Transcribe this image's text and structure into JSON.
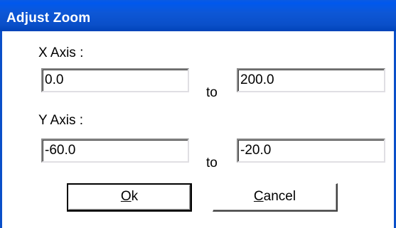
{
  "window": {
    "title": "Adjust Zoom"
  },
  "x_axis": {
    "label": "X Axis :",
    "from_value": "0.0",
    "to_label": "to",
    "to_value": "200.0"
  },
  "y_axis": {
    "label": "Y Axis :",
    "from_value": "-60.0",
    "to_label": "to",
    "to_value": "-20.0"
  },
  "buttons": {
    "ok_mnemonic": "O",
    "ok_rest": "k",
    "cancel_mnemonic": "C",
    "cancel_rest": "ancel"
  },
  "colors": {
    "titlebar": "#0a4fc9",
    "client_background": "#ffffff"
  }
}
